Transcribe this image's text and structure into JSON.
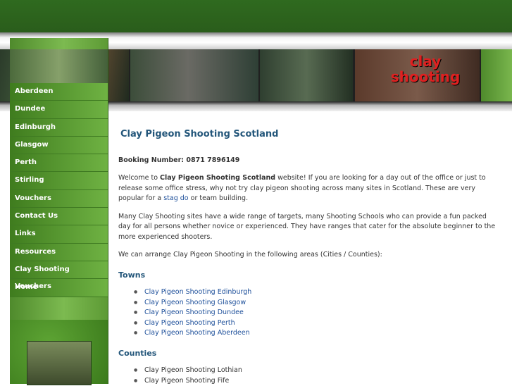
{
  "nav": [
    "Aberdeen",
    "Dundee",
    "Edinburgh",
    "Glasgow",
    "Perth",
    "Stirling",
    "Vouchers",
    "Contact Us",
    "Links",
    "Resources",
    "Clay Shooting Vouchers",
    "Home"
  ],
  "banner": {
    "logo_line1": "clay",
    "logo_line2": "shooting"
  },
  "content": {
    "title": "Clay Pigeon Shooting Scotland",
    "booking": "Booking Number: 0871 7896149",
    "welcome_a": "Welcome to ",
    "welcome_b": "Clay Pigeon Shooting Scotland",
    "welcome_c": " website! If you are looking for a day out of the office or just to release some office stress, why not try clay pigeon shooting across many sites in Scotland. These are very popular for a ",
    "welcome_link": "stag do",
    "welcome_d": " or team building.",
    "para2": "Many Clay Shooting sites have a wide range of targets, many Shooting Schools who can provide a fun packed day for all persons whether novice or experienced. They have ranges that cater for the absolute beginner to the more experienced shooters.",
    "para3": "We can arrange Clay Pigeon Shooting in the following areas (Cities / Counties):",
    "towns_heading": "Towns",
    "towns": [
      "Clay Pigeon Shooting Edinburgh",
      "Clay Pigeon Shooting Glasgow",
      "Clay Pigeon Shooting Dundee",
      "Clay Pigeon Shooting Perth",
      "Clay Pigeon Shooting Aberdeen"
    ],
    "counties_heading": "Counties",
    "counties": [
      "Clay Pigeon Shooting Lothian",
      "Clay Pigeon Shooting Fife"
    ]
  }
}
